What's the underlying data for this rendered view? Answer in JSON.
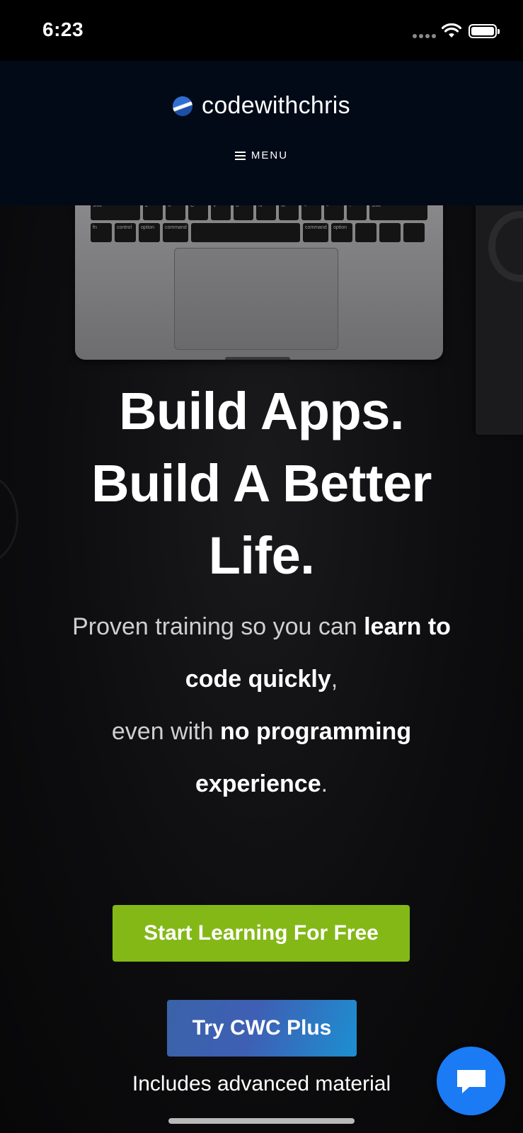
{
  "status_bar": {
    "time": "6:23"
  },
  "header": {
    "brand": "codewithchris",
    "menu_label": "MENU"
  },
  "hero": {
    "headline_lines": [
      "Build Apps.",
      "Build A Better",
      "Life."
    ],
    "sub": {
      "p1": "Proven training so you can ",
      "b1": "learn to code quickly",
      "p2": ",",
      "p3": "even with ",
      "b2": "no programming experience",
      "p4": "."
    },
    "keyboard_labels": [
      "shift",
      "Z",
      "X",
      "C",
      "V",
      "B",
      "N",
      "M",
      "<",
      ">",
      "?",
      "shift",
      "fn",
      "control",
      "option",
      "command",
      "command",
      "option"
    ]
  },
  "cta": {
    "primary_label": "Start Learning For Free",
    "primary_color": "#84b817",
    "secondary_label": "Try CWC Plus",
    "secondary_note": "Includes advanced material"
  },
  "chat": {
    "icon": "chat-bubble-icon",
    "color": "#1a7bf5"
  }
}
